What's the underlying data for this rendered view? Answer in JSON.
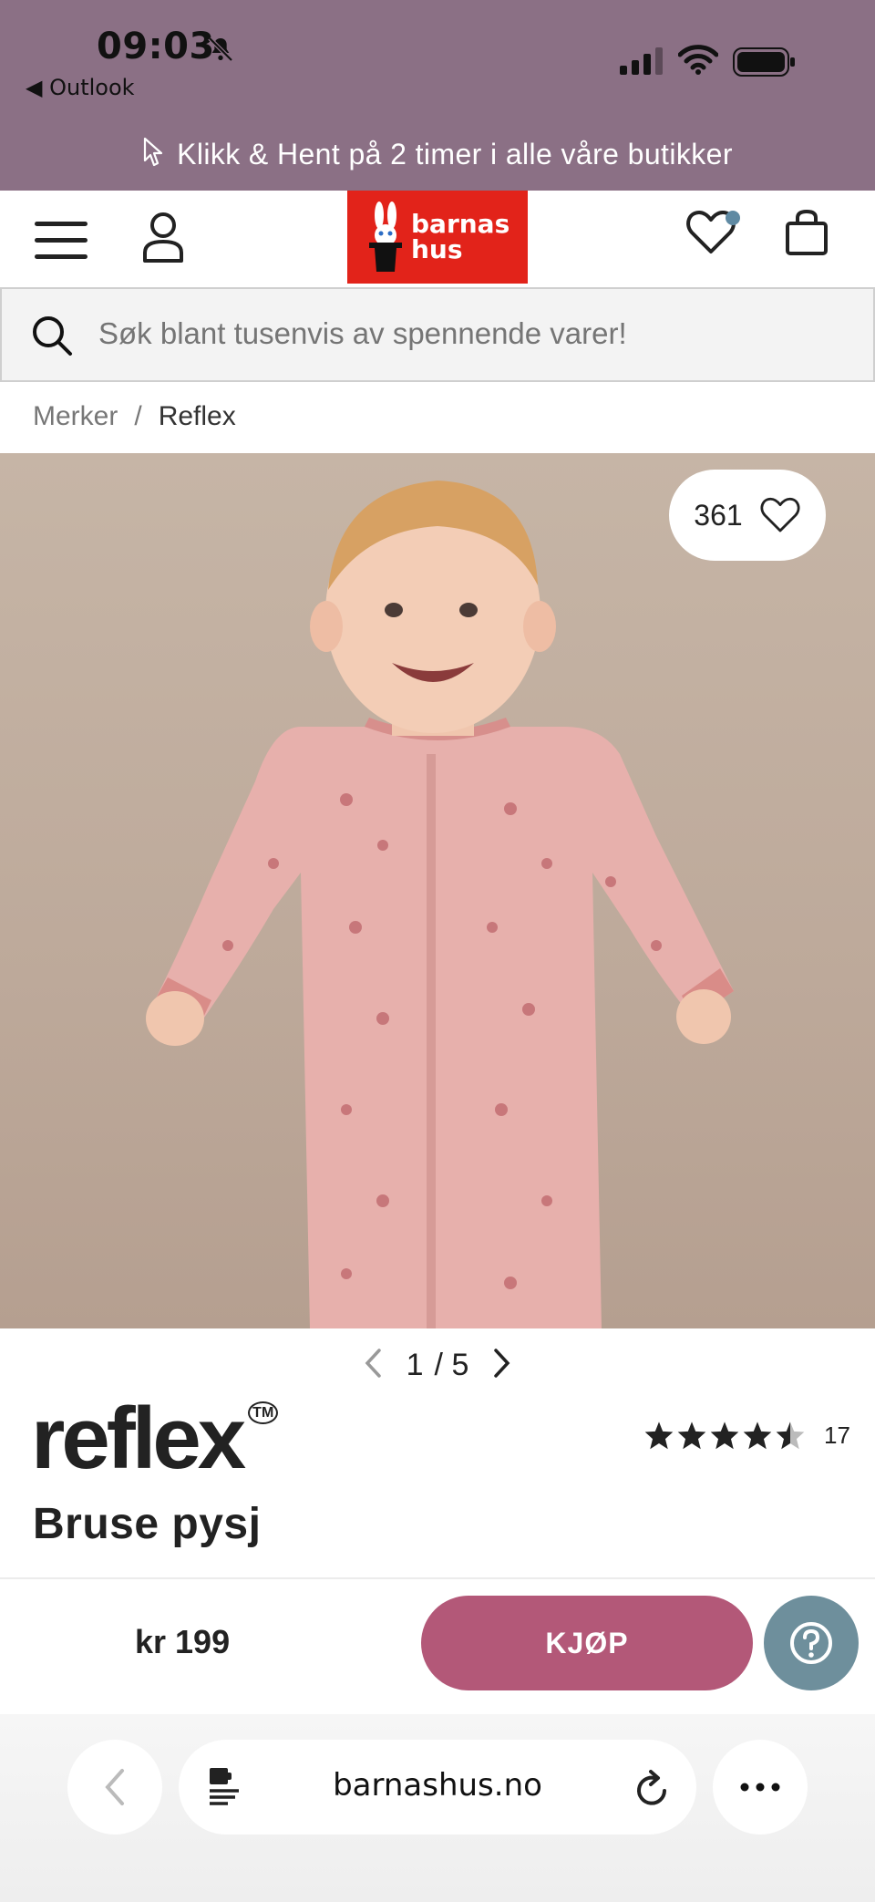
{
  "status_bar": {
    "time": "09:03",
    "back_app": "Outlook"
  },
  "promo": {
    "text": "Klikk & Hent på 2 timer i alle våre butikker"
  },
  "header": {
    "logo_line1": "barnas",
    "logo_line2": "hus",
    "wishlist_has_items": true
  },
  "search": {
    "placeholder": "Søk blant tusenvis av spennende varer!"
  },
  "breadcrumb": {
    "items": [
      "Merker",
      "Reflex"
    ],
    "separator": "/"
  },
  "product": {
    "favorites_count": "361",
    "image_index": "1",
    "image_total": "5",
    "brand": "reflex",
    "brand_tm": "TM",
    "name": "Bruse pysj",
    "rating": 4.5,
    "review_count": "17",
    "price": "kr 199",
    "buy_label": "KJØP"
  },
  "browser": {
    "url": "barnashus.no"
  },
  "colors": {
    "promo_bg": "#8b7085",
    "logo_red": "#e2231a",
    "buy_button": "#b35878",
    "help_button": "#6e8f9c",
    "wishlist_dot": "#5f8aa3"
  },
  "icons": [
    "bell-slash-icon",
    "signal-icon",
    "wifi-icon",
    "battery-icon",
    "cursor-icon",
    "menu-icon",
    "user-icon",
    "heart-icon",
    "bag-icon",
    "search-icon",
    "chevron-left-icon",
    "chevron-right-icon",
    "star-icon",
    "question-icon",
    "reload-icon",
    "more-icon",
    "tab-icon"
  ]
}
